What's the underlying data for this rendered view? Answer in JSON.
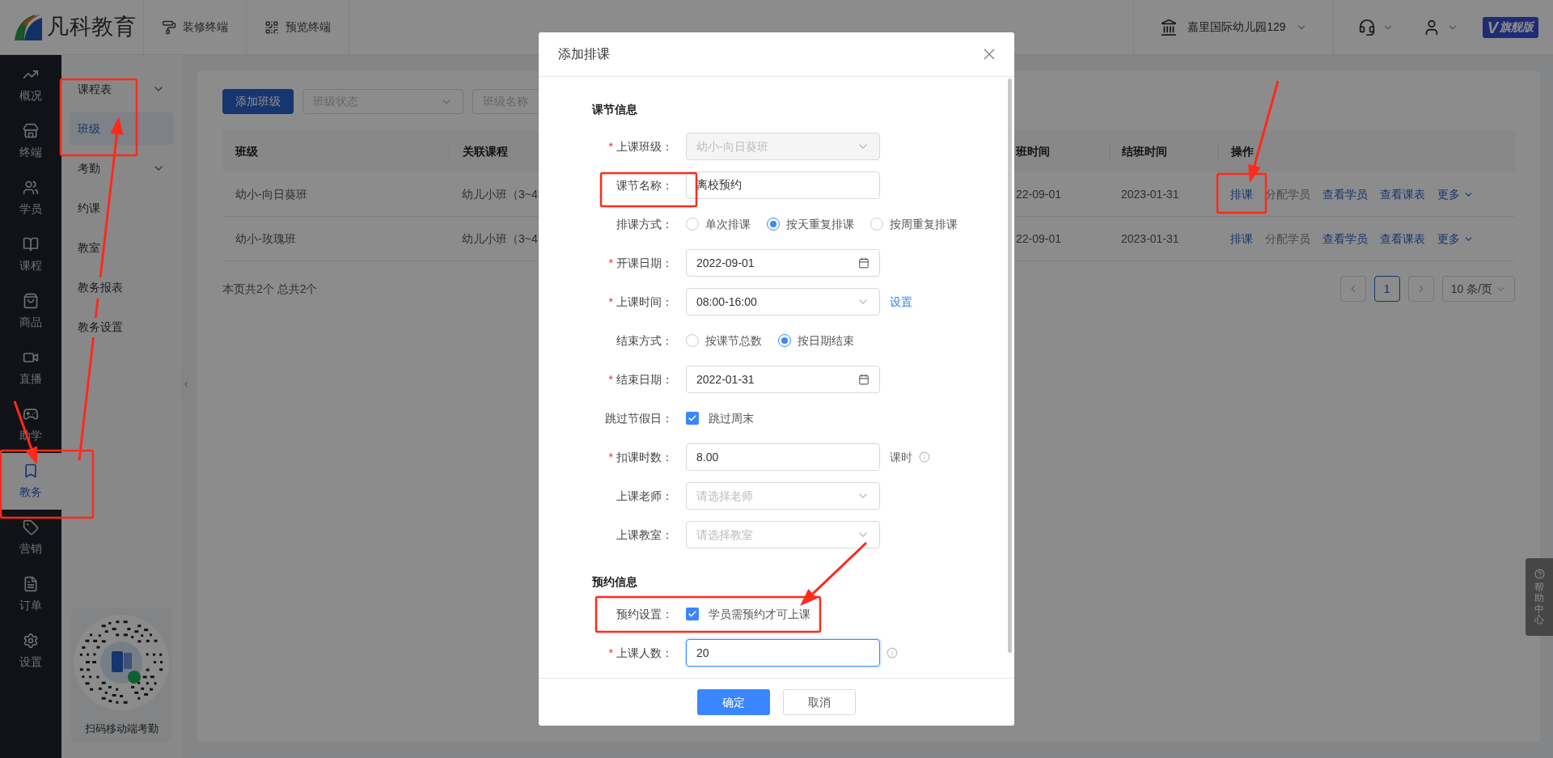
{
  "top_bar": {
    "logo": "凡科教育",
    "actions": [
      {
        "kind": "decorate",
        "label": "装修终端"
      },
      {
        "kind": "preview",
        "label": "预览终端"
      }
    ],
    "school": "嘉里国际幼儿园129",
    "edition": {
      "mark": "V",
      "label": "旗舰版"
    }
  },
  "sidebar": {
    "items": [
      {
        "kind": "overview",
        "label": "概况",
        "selected": false
      },
      {
        "kind": "terminal",
        "label": "终端",
        "selected": false
      },
      {
        "kind": "students",
        "label": "学员",
        "selected": false
      },
      {
        "kind": "course",
        "label": "课程",
        "selected": false
      },
      {
        "kind": "goods",
        "label": "商品",
        "selected": false
      },
      {
        "kind": "live",
        "label": "直播",
        "selected": false
      },
      {
        "kind": "study",
        "label": "助学",
        "selected": false
      },
      {
        "kind": "academic",
        "label": "教务",
        "selected": true
      },
      {
        "kind": "marketing",
        "label": "营销",
        "selected": false
      },
      {
        "kind": "orders",
        "label": "订单",
        "selected": false
      },
      {
        "kind": "settings",
        "label": "设置",
        "selected": false
      }
    ]
  },
  "subnav": {
    "items": [
      {
        "label": "课程表",
        "expandable": true,
        "selected": false
      },
      {
        "label": "班级",
        "expandable": false,
        "selected": true
      },
      {
        "label": "考勤",
        "expandable": true,
        "selected": false
      },
      {
        "label": "约课",
        "expandable": false,
        "selected": false
      },
      {
        "label": "教室",
        "expandable": false,
        "selected": false
      },
      {
        "label": "教务报表",
        "expandable": false,
        "selected": false
      },
      {
        "label": "教务设置",
        "expandable": false,
        "selected": false
      }
    ],
    "qr_caption": "扫码移动端考勤"
  },
  "toolbar": {
    "add_button": "添加班级",
    "status_filter": {
      "placeholder": "班级状态"
    },
    "name_filter": {
      "placeholder": "班级名称"
    }
  },
  "table": {
    "columns": [
      "班级",
      "关联课程",
      "班时间",
      "结班时间",
      "操作"
    ],
    "rows": [
      {
        "cells": [
          "幼小-向日葵班",
          "幼儿小班（3~4",
          "22-09-01",
          "2023-01-31"
        ],
        "actions": [
          {
            "label": "排课",
            "disabled": false,
            "menu": false
          },
          {
            "label": "分配学员",
            "disabled": true,
            "menu": false
          },
          {
            "label": "查看学员",
            "disabled": false,
            "menu": false
          },
          {
            "label": "查看课表",
            "disabled": false,
            "menu": false
          },
          {
            "label": "更多",
            "disabled": false,
            "menu": true
          }
        ]
      },
      {
        "cells": [
          "幼小-玫瑰班",
          "幼儿小班（3~4",
          "22-09-01",
          "2023-01-31"
        ],
        "actions": [
          {
            "label": "排课",
            "disabled": false,
            "menu": false
          },
          {
            "label": "分配学员",
            "disabled": true,
            "menu": false
          },
          {
            "label": "查看学员",
            "disabled": false,
            "menu": false
          },
          {
            "label": "查看课表",
            "disabled": false,
            "menu": false
          },
          {
            "label": "更多",
            "disabled": false,
            "menu": true
          }
        ]
      }
    ]
  },
  "summary": "本页共2个 总共2个",
  "pagination": {
    "pages": [
      {
        "label": "1",
        "selected": true
      }
    ],
    "page_size": "10 条/页"
  },
  "help_tab": {
    "label": "帮助中心"
  },
  "dialog": {
    "title": "添加排课",
    "sections": [
      {
        "title": "课节信息",
        "fields": [
          {
            "kind": "select",
            "label": "上课班级：",
            "marker": "*",
            "value": "幼小-向日葵班",
            "disabled": true
          },
          {
            "kind": "input",
            "label": "课节名称：",
            "value": "离校预约"
          },
          {
            "kind": "radio",
            "label": "排课方式：",
            "options": [
              {
                "label": "单次排课",
                "selected": false
              },
              {
                "label": "按天重复排课",
                "selected": true
              },
              {
                "label": "按周重复排课",
                "selected": false
              }
            ]
          },
          {
            "kind": "date",
            "label": "开课日期：",
            "marker": "*",
            "value": "2022-09-01"
          },
          {
            "kind": "select",
            "label": "上课时间：",
            "marker": "*",
            "value": "08:00-16:00",
            "link": "设置"
          },
          {
            "kind": "radio",
            "label": "结束方式：",
            "options": [
              {
                "label": "按课节总数",
                "selected": false
              },
              {
                "label": "按日期结束",
                "selected": true
              }
            ]
          },
          {
            "kind": "date",
            "label": "结束日期：",
            "marker": "*",
            "value": "2022-01-31"
          },
          {
            "kind": "checkbox",
            "label": "跳过节假日：",
            "option": "跳过周末",
            "checked": true
          },
          {
            "kind": "input",
            "label": "扣课时数：",
            "marker": "*",
            "value": "8.00",
            "unit": "课时",
            "info": true
          },
          {
            "kind": "select",
            "label": "上课老师：",
            "placeholder": "请选择老师"
          },
          {
            "kind": "select",
            "label": "上课教室：",
            "placeholder": "请选择教室"
          }
        ]
      },
      {
        "title": "预约信息",
        "fields": [
          {
            "kind": "checkbox",
            "label": "预约设置：",
            "option": "学员需预约才可上课",
            "checked": true
          },
          {
            "kind": "input",
            "label": "上课人数：",
            "marker": "*",
            "value": "20",
            "info": true,
            "focused": true
          }
        ]
      }
    ],
    "buttons": [
      {
        "label": "确定",
        "primary": true
      },
      {
        "label": "取消",
        "primary": false
      }
    ]
  }
}
